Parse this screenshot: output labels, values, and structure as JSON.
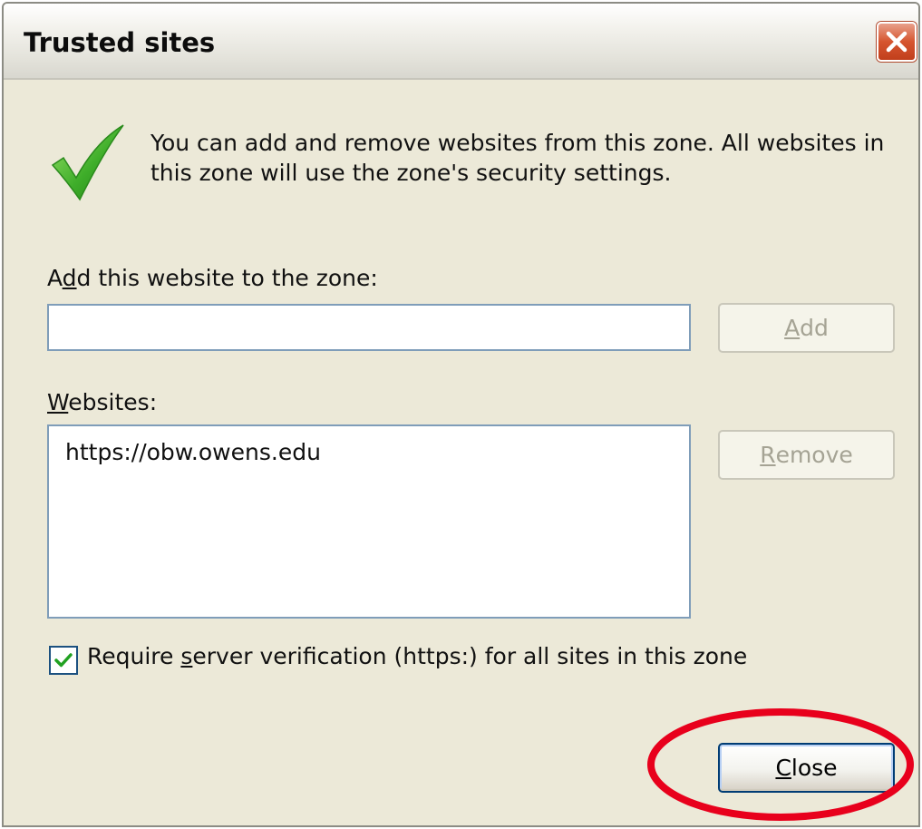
{
  "window": {
    "title": "Trusted sites"
  },
  "description": "You can add and remove websites from this zone. All websites in this zone will use the zone's security settings.",
  "add_section": {
    "label_prefix": "A",
    "label_mnemonic": "d",
    "label_suffix": "d this website to the zone:",
    "input_value": "",
    "add_button": {
      "mnemonic": "A",
      "rest": "dd",
      "enabled": false
    }
  },
  "websites_section": {
    "label_mnemonic": "W",
    "label_rest": "ebsites:",
    "items": [
      "https://obw.owens.edu"
    ],
    "remove_button": {
      "mnemonic": "R",
      "rest": "emove",
      "enabled": false
    }
  },
  "verification": {
    "checked": true,
    "label_prefix": "Require ",
    "label_mnemonic": "s",
    "label_suffix": "erver verification (https:) for all sites in this zone"
  },
  "close_button": {
    "mnemonic": "C",
    "rest": "lose"
  },
  "highlight": {
    "color": "#e8001c",
    "target": "close-button"
  },
  "icons": {
    "title_close": "close-icon",
    "description": "checkmark-icon",
    "checkbox": "check-icon"
  }
}
